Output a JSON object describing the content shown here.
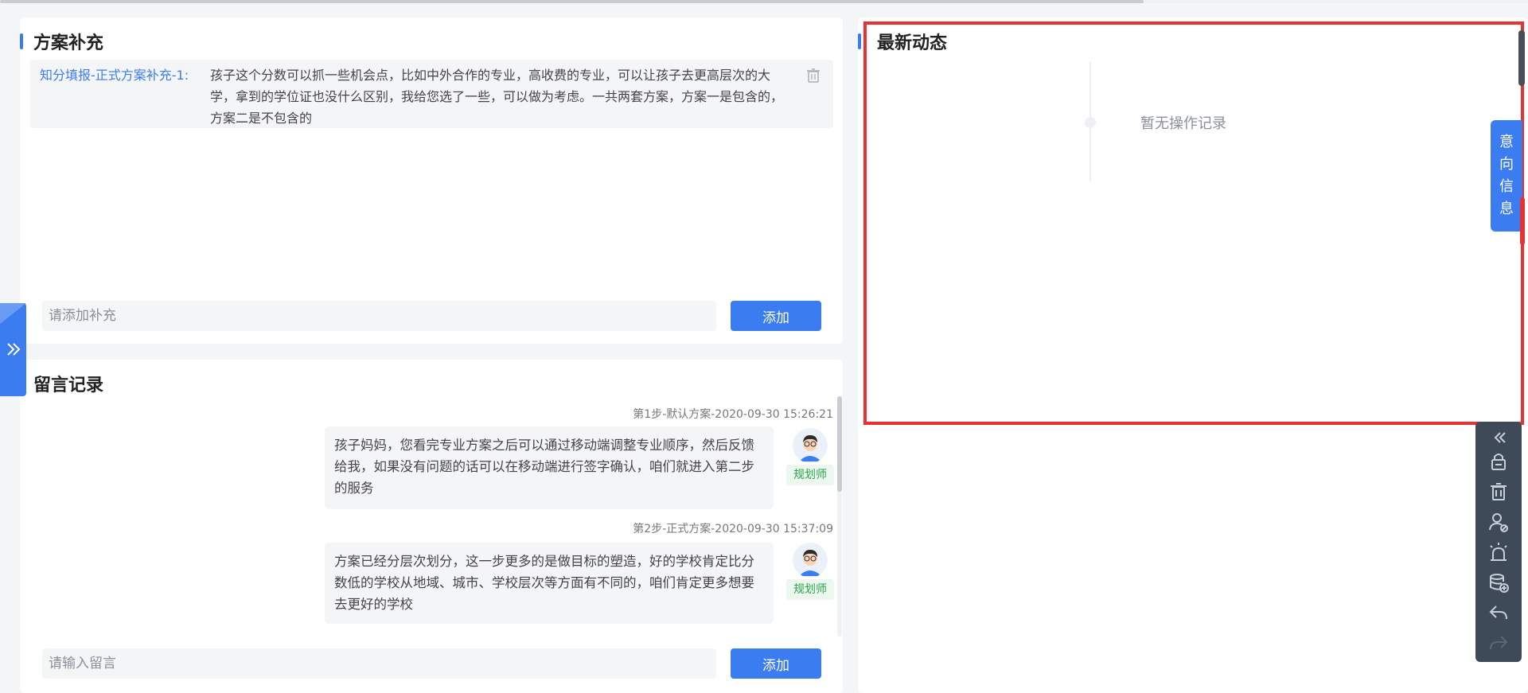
{
  "supplement": {
    "title": "方案补充",
    "items": [
      {
        "label": "知分填报-正式方案补充-1:",
        "text": "孩子这个分数可以抓一些机会点，比如中外合作的专业，高收费的专业，可以让孩子去更高层次的大学，拿到的学位证也没什么区别，我给您选了一些，可以做为考虑。一共两套方案，方案一是包含的，方案二是不包含的"
      }
    ],
    "input_placeholder": "请添加补充",
    "add_label": "添加"
  },
  "messages": {
    "title": "留言记录",
    "items": [
      {
        "meta": "第1步-默认方案-2020-09-30 15:26:21",
        "text": "孩子妈妈，您看完专业方案之后可以通过移动端调整专业顺序，然后反馈给我，如果没有问题的话可以在移动端进行签字确认，咱们就进入第二步的服务",
        "role": "规划师"
      },
      {
        "meta": "第2步-正式方案-2020-09-30 15:37:09",
        "text": "方案已经分层次划分，这一步更多的是做目标的塑造，好的学校肯定比分数低的学校从地域、城市、学校层次等方面有不同的，咱们肯定更多想要去更好的学校",
        "role": "规划师"
      }
    ],
    "input_placeholder": "请输入留言",
    "add_label": "添加"
  },
  "latest": {
    "title": "最新动态",
    "empty_text": "暂无操作记录"
  },
  "intent_tab": [
    "意",
    "向",
    "信",
    "息"
  ],
  "tools": [
    "collapse-icon",
    "lock-icon",
    "trash-icon",
    "user-block-icon",
    "alarm-icon",
    "database-add-icon",
    "reply-icon",
    "forward-icon"
  ],
  "colors": {
    "accent": "#3b7cf0",
    "highlight": "#e53232",
    "toolbar": "#3f4a59",
    "role": "#2aa44a"
  }
}
